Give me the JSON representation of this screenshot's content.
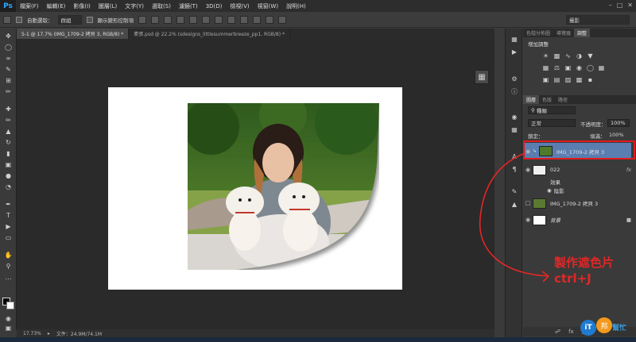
{
  "app": {
    "logo": "Ps"
  },
  "menu": [
    "檔案(F)",
    "編輯(E)",
    "影像(I)",
    "圖層(L)",
    "文字(Y)",
    "選取(S)",
    "濾鏡(T)",
    "3D(D)",
    "檢視(V)",
    "視窗(W)",
    "說明(H)"
  ],
  "options": {
    "auto_select_label": "自動選取：",
    "auto_select_value": "群組",
    "transform_label": "顯示變形控制項",
    "workspace": "攝影"
  },
  "tabs": [
    {
      "label": "5-1 @ 17.7% (IMG_1709-2 拷貝 3, RGB/8) *",
      "active": true
    },
    {
      "label": "素張.psd @ 22.2% (sdesigns_littlesummerbreeze_pp1, RGB/8) *",
      "active": false
    }
  ],
  "status": {
    "zoom": "17.73%",
    "doc": "文件：24.9M/74.1M"
  },
  "panels": {
    "top_tabs": [
      "色階分佈圖",
      "導覽器",
      "調整"
    ],
    "adjust_title": "增加調整",
    "layers_tabs": [
      "圖層",
      "色版",
      "路徑"
    ],
    "kind_filter": "種類",
    "blend_mode": "正常",
    "opacity_label": "不透明度：",
    "opacity_value": "100%",
    "lock_label": "鎖定：",
    "fill_label": "填滿：",
    "fill_value": "100%"
  },
  "layers": [
    {
      "name": "IMG_1709-2 拷貝 3",
      "selected": true
    },
    {
      "name": "022",
      "fx": "fx"
    },
    {
      "name": "效果",
      "sub": true
    },
    {
      "name": "陰影",
      "sub": true
    },
    {
      "name": "IMG_1709-2 拷貝 3",
      "hidden": true
    },
    {
      "name": "背景",
      "locked": true
    }
  ],
  "annotation": {
    "line1": "製作遮色片",
    "line2": "ctrl+J"
  },
  "watermark": {
    "left": "iT",
    "mid": "邦",
    "right": "幫忙"
  },
  "colors": {
    "accent": "#31a8ff",
    "annotation": "#e32626",
    "selection": "#5b7eb1"
  }
}
